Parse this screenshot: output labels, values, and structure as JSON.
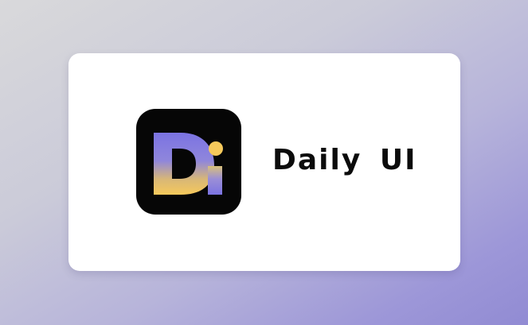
{
  "brand": {
    "logo_name": "daily-ui-logo",
    "logo_letters": "Di",
    "name": "Daily  UI"
  },
  "colors": {
    "tile": "#060606",
    "gradient_top": "#7a72e0",
    "gradient_bottom": "#f5c85c",
    "dot": "#f5c85c",
    "text": "#0b0b0b"
  }
}
